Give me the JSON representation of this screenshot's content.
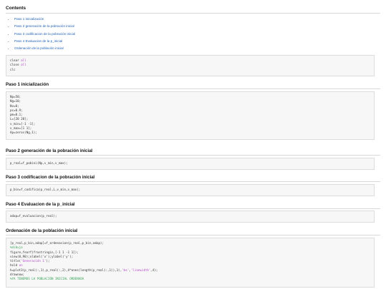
{
  "contents": {
    "title": "Contents",
    "items": [
      "Paso 1 inicialización",
      "Paso 2 generación de la pobración inicial",
      "Paso 3 codificacion de la pobración inicial",
      "Paso 4 Evaluacion de la p_inicial",
      "Ordenación de la población inicial"
    ]
  },
  "code_init": {
    "lines": [
      [
        "clear ",
        "all"
      ],
      [
        "close ",
        "all"
      ],
      [
        "clc",
        ""
      ]
    ]
  },
  "sections": [
    {
      "title": "Paso 1 inicialización",
      "lines": [
        "Np=50;",
        "Ng=10;",
        "Nv=0;",
        "pc=0.9;",
        "pm=0.1;",
        "L=[20 20];",
        "v_min=[-1 -1];",
        "v_max=[1 1];",
        "Ap=zeros(Ng,1);"
      ]
    },
    {
      "title": "Paso 2 generación de la pobración inicial",
      "lines": [
        "p_real=f_pobini(Np,v_min,v_max);"
      ]
    },
    {
      "title": "Paso 3 codificacion de la pobración inicial",
      "lines": [
        "p_bin=f_codifica(p_real,L,v_min,v_max);"
      ]
    },
    {
      "title": "Paso 4 Evaluacion de la p_inicial",
      "lines": [
        "adap=f_evaluacion(p_real);"
      ]
    },
    {
      "title": "Ordenación de la población inicial"
    }
  ],
  "code_last": {
    "l1": "[p_real,p_bin,adap]=f_ordenacion(p_real,p_bin,adap);",
    "l2": "%dibujo",
    "l3": "figure,fearf(frastringin,[-1 1 -1 1]);",
    "l4": "view(0,90);xlabel('x');ylabel('y');",
    "l5a": "title(",
    "l5b": "'Generación 1'",
    "l5c": ");",
    "l6a": "hold ",
    "l6b": "on",
    "l7a": "h=plot3(p_real(:,1),p_real(:,2),4*ones(length(p_real(:,1)),1),",
    "l7b": "'bo'",
    "l7c": ",",
    "l7d": "'linewidth'",
    "l7e": ",4);",
    "l8": "drawnow;",
    "l9": "%YA TENEMOS LA POBLACIÓN INICIAL ORDENADA"
  }
}
